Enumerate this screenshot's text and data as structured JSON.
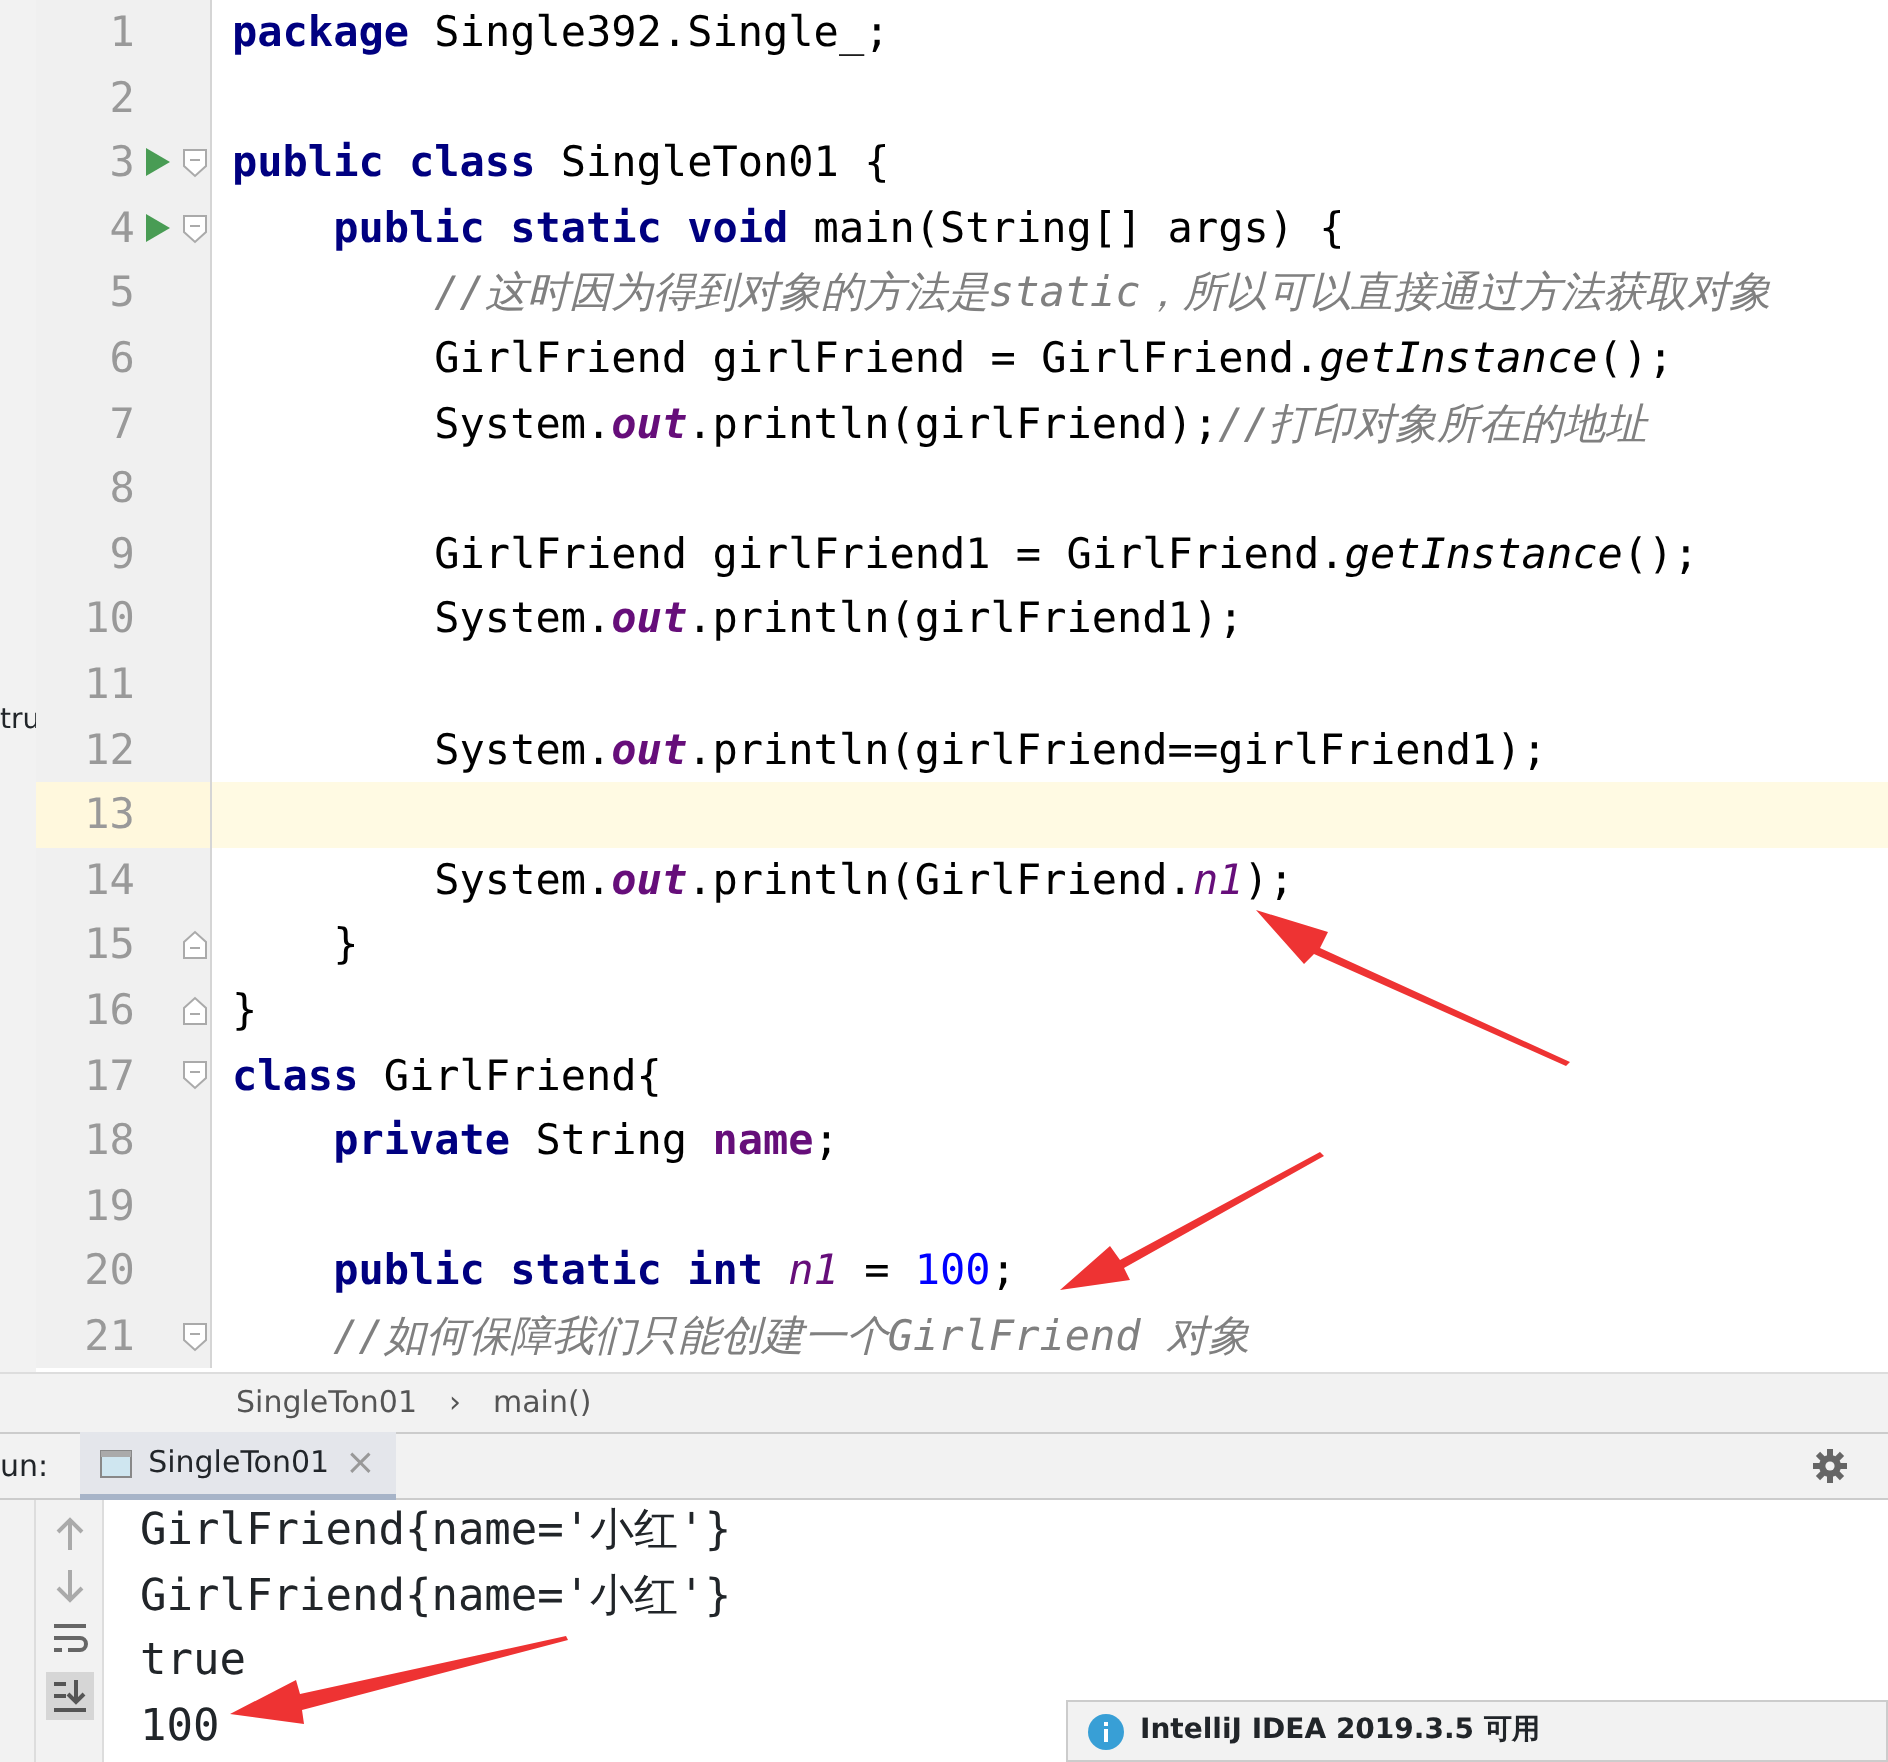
{
  "project_panel": {
    "visible_text": "tru"
  },
  "editor": {
    "lines": [
      {
        "number": "1",
        "run": false,
        "current": false,
        "fold_start": false,
        "fold_end": false,
        "tokens": [
          {
            "kind": "keyword",
            "t": "package"
          },
          {
            "kind": "plain",
            "t": " Single392.Single_;"
          }
        ]
      },
      {
        "number": "2",
        "run": false,
        "current": false,
        "fold_start": false,
        "fold_end": false
      },
      {
        "number": "3",
        "run": true,
        "current": false,
        "fold_start": true,
        "fold_end": false,
        "tokens": [
          {
            "kind": "keyword",
            "t": "public class"
          },
          {
            "kind": "plain",
            "t": " SingleTon01 {"
          }
        ]
      },
      {
        "number": "4",
        "run": true,
        "current": false,
        "fold_start": true,
        "fold_end": false,
        "tokens": [
          {
            "kind": "keyword",
            "t": "    public static void"
          },
          {
            "kind": "plain",
            "t": " main(String[] args) {"
          }
        ]
      },
      {
        "number": "5",
        "run": false,
        "current": false,
        "fold_start": false,
        "fold_end": false,
        "tokens": [
          {
            "kind": "comment",
            "t": "        //这时因为得到对象的方法是static，所以可以直接通过方法获取对象"
          }
        ]
      },
      {
        "number": "6",
        "run": false,
        "current": false,
        "fold_start": false,
        "fold_end": false,
        "tokens": [
          {
            "kind": "plain",
            "t": "        GirlFriend girlFriend = GirlFriend."
          },
          {
            "kind": "static_call",
            "t": "getInstance"
          },
          {
            "kind": "plain",
            "t": "();"
          }
        ]
      },
      {
        "number": "7",
        "run": false,
        "current": false,
        "fold_start": false,
        "fold_end": false,
        "tokens": [
          {
            "kind": "plain",
            "t": "        System."
          },
          {
            "kind": "static_field",
            "t": "out"
          },
          {
            "kind": "plain",
            "t": ".println(girlFriend);"
          },
          {
            "kind": "comment",
            "t": "//打印对象所在的地址"
          }
        ]
      },
      {
        "number": "8",
        "run": false,
        "current": false,
        "fold_start": false,
        "fold_end": false
      },
      {
        "number": "9",
        "run": false,
        "current": false,
        "fold_start": false,
        "fold_end": false,
        "tokens": [
          {
            "kind": "plain",
            "t": "        GirlFriend girlFriend1 = GirlFriend."
          },
          {
            "kind": "static_call",
            "t": "getInstance"
          },
          {
            "kind": "plain",
            "t": "();"
          }
        ]
      },
      {
        "number": "10",
        "run": false,
        "current": false,
        "fold_start": false,
        "fold_end": false,
        "tokens": [
          {
            "kind": "plain",
            "t": "        System."
          },
          {
            "kind": "static_field",
            "t": "out"
          },
          {
            "kind": "plain",
            "t": ".println(girlFriend1);"
          }
        ]
      },
      {
        "number": "11",
        "run": false,
        "current": false,
        "fold_start": false,
        "fold_end": false
      },
      {
        "number": "12",
        "run": false,
        "current": false,
        "fold_start": false,
        "fold_end": false,
        "tokens": [
          {
            "kind": "plain",
            "t": "        System."
          },
          {
            "kind": "static_field",
            "t": "out"
          },
          {
            "kind": "plain",
            "t": ".println(girlFriend==girlFriend1);"
          }
        ]
      },
      {
        "number": "13",
        "run": false,
        "current": true,
        "fold_start": false,
        "fold_end": false
      },
      {
        "number": "14",
        "run": false,
        "current": false,
        "fold_start": false,
        "fold_end": false,
        "tokens": [
          {
            "kind": "plain",
            "t": "        System."
          },
          {
            "kind": "static_field",
            "t": "out"
          },
          {
            "kind": "plain",
            "t": ".println(GirlFriend."
          },
          {
            "kind": "static_var",
            "t": "n1"
          },
          {
            "kind": "plain",
            "t": ");"
          }
        ]
      },
      {
        "number": "15",
        "run": false,
        "current": false,
        "fold_start": false,
        "fold_end": true,
        "tokens": [
          {
            "kind": "plain",
            "t": "    }"
          }
        ]
      },
      {
        "number": "16",
        "run": false,
        "current": false,
        "fold_start": false,
        "fold_end": true,
        "tokens": [
          {
            "kind": "plain",
            "t": "}"
          }
        ]
      },
      {
        "number": "17",
        "run": false,
        "current": false,
        "fold_start": true,
        "fold_end": false,
        "tokens": [
          {
            "kind": "keyword",
            "t": "class"
          },
          {
            "kind": "plain",
            "t": " GirlFriend{"
          }
        ]
      },
      {
        "number": "18",
        "run": false,
        "current": false,
        "fold_start": false,
        "fold_end": false,
        "tokens": [
          {
            "kind": "keyword",
            "t": "    private"
          },
          {
            "kind": "plain",
            "t": " String "
          },
          {
            "kind": "field",
            "t": "name"
          },
          {
            "kind": "plain",
            "t": ";"
          }
        ]
      },
      {
        "number": "19",
        "run": false,
        "current": false,
        "fold_start": false,
        "fold_end": false
      },
      {
        "number": "20",
        "run": false,
        "current": false,
        "fold_start": false,
        "fold_end": false,
        "tokens": [
          {
            "kind": "keyword",
            "t": "    public static int"
          },
          {
            "kind": "static_var",
            "t": " n1"
          },
          {
            "kind": "plain",
            "t": " = "
          },
          {
            "kind": "number",
            "t": "100"
          },
          {
            "kind": "plain",
            "t": ";"
          }
        ]
      },
      {
        "number": "21",
        "run": false,
        "current": false,
        "fold_start": true,
        "fold_end": false,
        "tokens": [
          {
            "kind": "comment",
            "t": "    //如何保障我们只能创建一个GirlFriend 对象"
          }
        ]
      }
    ]
  },
  "breadcrumb": [
    "SingleTon01",
    "main()"
  ],
  "breadcrumb_separator": "›",
  "run_panel": {
    "label": "un:",
    "tabs": [
      {
        "title": "SingleTon01",
        "close": "×",
        "selected": true
      }
    ],
    "output": [
      "GirlFriend{name='小红'}",
      "GirlFriend{name='小红'}",
      "true",
      "100"
    ]
  },
  "notification": {
    "text": "IntelliJ IDEA 2019.3.5 可用"
  }
}
